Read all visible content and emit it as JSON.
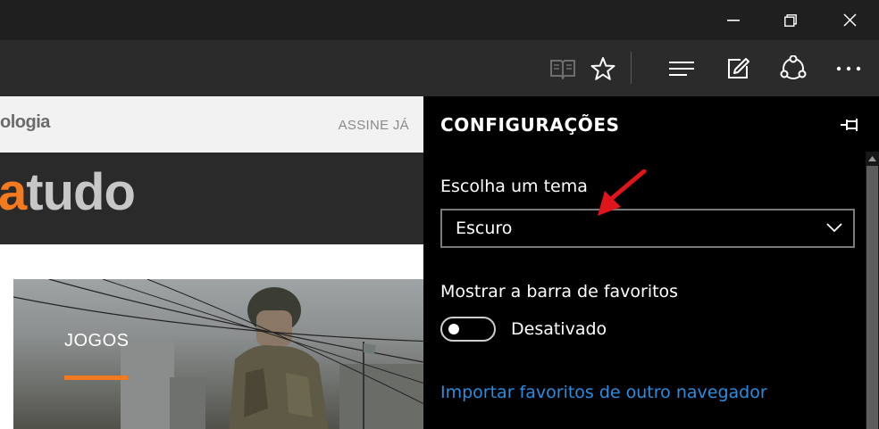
{
  "window_controls": {
    "minimize_icon": "minimize-icon",
    "restore_icon": "restore-icon",
    "close_icon": "close-icon"
  },
  "toolbar": {
    "reading_view_icon": "book-icon",
    "favorite_icon": "star-icon",
    "hub_icon": "hub-icon",
    "web_note_icon": "edit-note-icon",
    "share_icon": "share-icon",
    "more_icon": "more-icon"
  },
  "webpage": {
    "section_title": "ologia",
    "subscribe_label": "ASSINE JÁ",
    "logo_accent": "a",
    "logo_rest": "tudo",
    "hero_category": "JOGOS",
    "accent_color": "#f47a20"
  },
  "settings": {
    "title": "CONFIGURAÇÕES",
    "pin_icon": "pin-icon",
    "theme_label": "Escolha um tema",
    "theme_value": "Escuro",
    "favorites_bar_label": "Mostrar a barra de favoritos",
    "favorites_bar_state": "Desativado",
    "import_link": "Importar favoritos de outro navegador",
    "link_color": "#2a8de0"
  },
  "annotation": {
    "arrow_color": "#e0151b"
  }
}
